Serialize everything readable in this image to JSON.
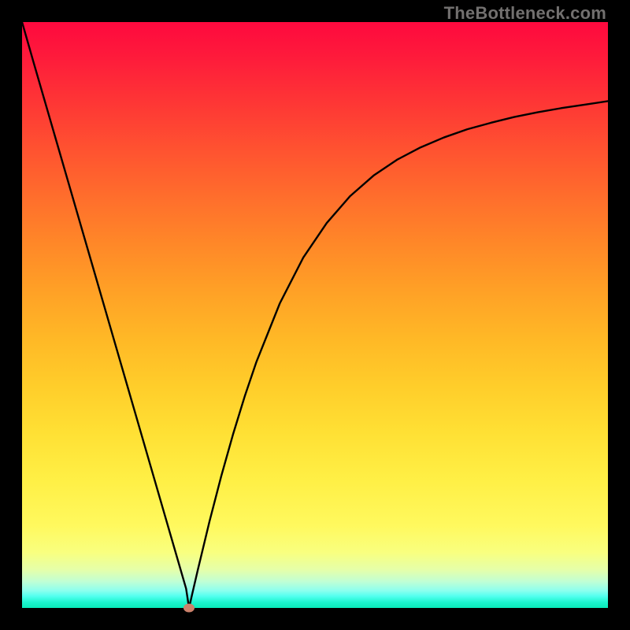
{
  "watermark": "TheBottleneck.com",
  "chart_data": {
    "type": "line",
    "title": "",
    "xlabel": "",
    "ylabel": "",
    "xlim": [
      0,
      1
    ],
    "ylim": [
      0,
      1
    ],
    "x": [
      0.0,
      0.02,
      0.04,
      0.06,
      0.08,
      0.1,
      0.12,
      0.14,
      0.16,
      0.18,
      0.2,
      0.22,
      0.24,
      0.26,
      0.28,
      0.285,
      0.29,
      0.3,
      0.32,
      0.34,
      0.36,
      0.38,
      0.4,
      0.44,
      0.48,
      0.52,
      0.56,
      0.6,
      0.64,
      0.68,
      0.72,
      0.76,
      0.8,
      0.84,
      0.88,
      0.92,
      0.96,
      1.0
    ],
    "y": [
      1.0,
      0.93,
      0.861,
      0.792,
      0.723,
      0.654,
      0.585,
      0.516,
      0.447,
      0.378,
      0.309,
      0.24,
      0.171,
      0.102,
      0.033,
      0.0,
      0.022,
      0.065,
      0.148,
      0.225,
      0.296,
      0.361,
      0.42,
      0.52,
      0.598,
      0.657,
      0.703,
      0.738,
      0.765,
      0.786,
      0.803,
      0.817,
      0.828,
      0.838,
      0.846,
      0.853,
      0.859,
      0.865
    ],
    "marker": {
      "x": 0.285,
      "y": 0.0
    },
    "background": {
      "type": "vertical-gradient",
      "stops": [
        {
          "pos": 0.0,
          "color": "#fe093e"
        },
        {
          "pos": 0.5,
          "color": "#ffad26"
        },
        {
          "pos": 0.88,
          "color": "#fffc6e"
        },
        {
          "pos": 1.0,
          "color": "#09eab8"
        }
      ]
    }
  }
}
